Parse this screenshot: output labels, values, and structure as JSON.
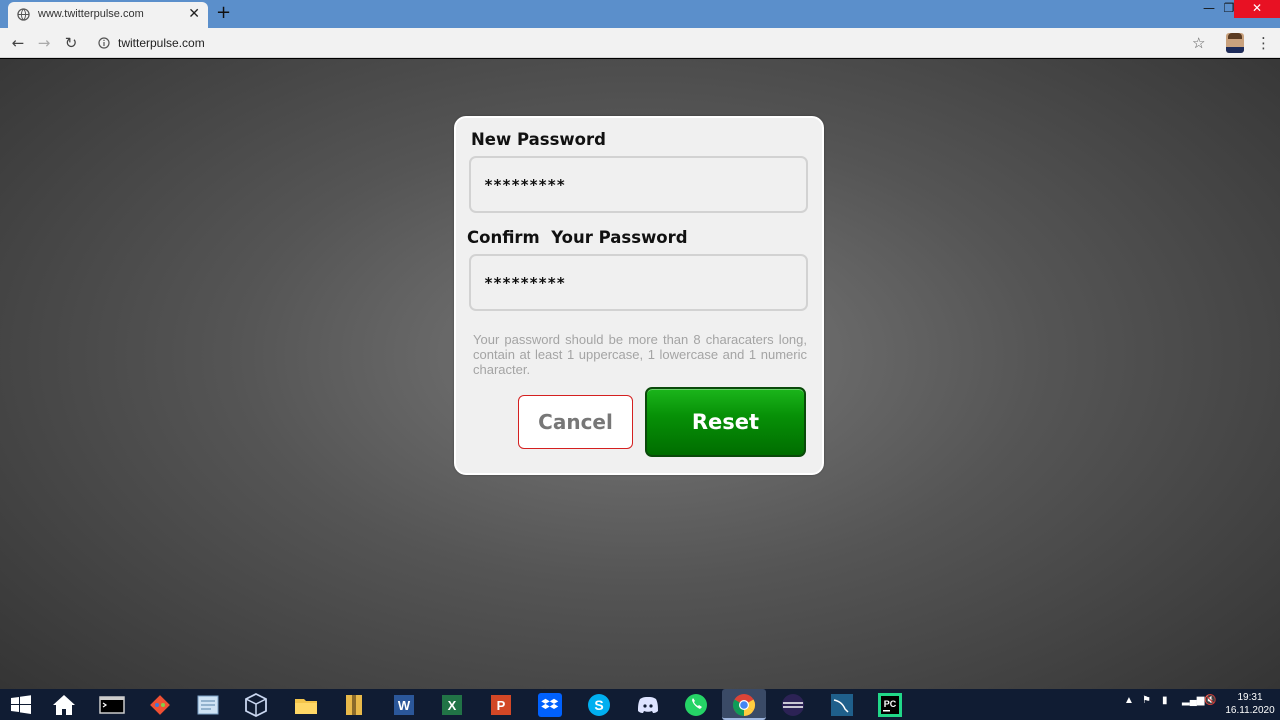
{
  "browser": {
    "tab_title": "www.twitterpulse.com",
    "tab_close": "✕",
    "new_tab": "+",
    "url": "twitterpulse.com",
    "window_controls": {
      "minimize": "—",
      "maximize": "❐",
      "close": "✕"
    },
    "nav": {
      "back": "←",
      "forward": "→",
      "reload": "↻",
      "star": "☆",
      "menu": "⋮"
    }
  },
  "form": {
    "new_password_label": "New Password",
    "new_password_value": "*********",
    "confirm_password_label": "Confirm  Your Password",
    "confirm_password_value": "*********",
    "hint": "Your password should be more than 8 characaters long, contain at least 1 uppercase, 1 lowercase and 1 numeric character.",
    "cancel_label": "Cancel",
    "reset_label": "Reset"
  },
  "taskbar": {
    "apps": [
      "windows-start",
      "home",
      "terminal",
      "git",
      "notepad",
      "virtualbox",
      "file-explorer",
      "archive",
      "word",
      "excel",
      "powerpoint",
      "dropbox",
      "skype",
      "discord",
      "whatsapp",
      "chrome",
      "eclipse",
      "mysql-workbench",
      "pycharm"
    ],
    "active_app": "chrome",
    "clock_time": "19:31",
    "clock_date": "16.11.2020"
  },
  "colors": {
    "tabstrip": "#5b8fcb",
    "reset_green": "#079107",
    "cancel_border": "#d42020",
    "taskbar": "#101c33"
  }
}
